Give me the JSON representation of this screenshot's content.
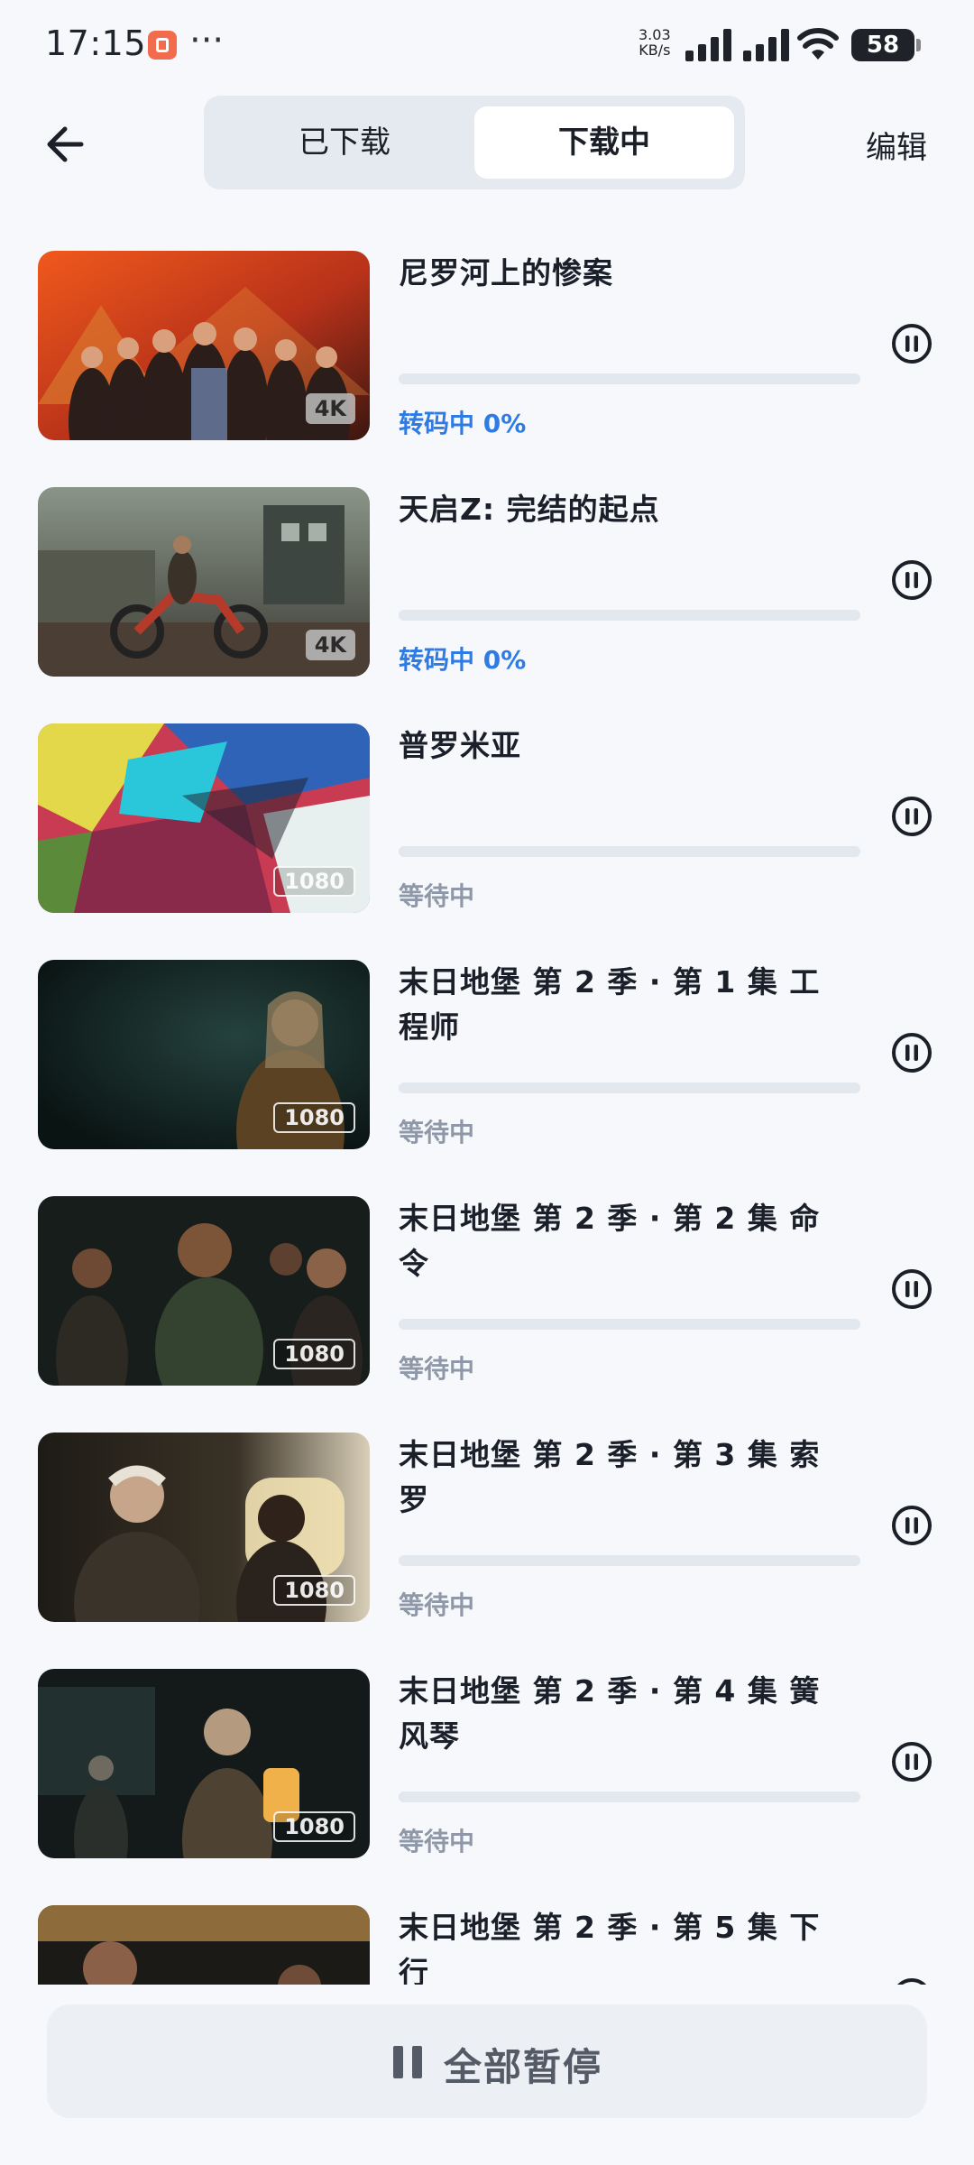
{
  "status_bar": {
    "time": "17:15",
    "speed_value": "3.03",
    "speed_unit": "KB/s",
    "battery": "58"
  },
  "header": {
    "tabs": [
      "已下载",
      "下载中"
    ],
    "active_tab": "下载中",
    "edit_label": "编辑"
  },
  "items": [
    {
      "title": "尼罗河上的惨案",
      "badge": "4K",
      "status": "转码中 0%",
      "status_type": "transcoding",
      "progress": 0
    },
    {
      "title": "天启Z: 完结的起点",
      "badge": "4K",
      "status": "转码中 0%",
      "status_type": "transcoding",
      "progress": 0
    },
    {
      "title": "普罗米亚",
      "badge": "1080",
      "status": "等待中",
      "status_type": "waiting",
      "progress": 0
    },
    {
      "title": "末日地堡 第 2 季 · 第 1 集 工程师",
      "badge": "1080",
      "status": "等待中",
      "status_type": "waiting",
      "progress": 0
    },
    {
      "title": "末日地堡 第 2 季 · 第 2 集 命令",
      "badge": "1080",
      "status": "等待中",
      "status_type": "waiting",
      "progress": 0
    },
    {
      "title": "末日地堡 第 2 季 · 第 3 集 索罗",
      "badge": "1080",
      "status": "等待中",
      "status_type": "waiting",
      "progress": 0
    },
    {
      "title": "末日地堡 第 2 季 · 第 4 集 簧风琴",
      "badge": "1080",
      "status": "等待中",
      "status_type": "waiting",
      "progress": 0
    },
    {
      "title": "末日地堡 第 2 季 · 第 5 集 下行",
      "badge": "",
      "status": "",
      "status_type": "waiting",
      "progress": 0
    }
  ],
  "pause_all_label": "全部暂停",
  "icons": {
    "back": "arrow-left-icon",
    "pause": "pause-circle-icon",
    "pause_all": "pause-icon"
  },
  "colors": {
    "accent": "#2e7be6",
    "waiting": "#8f98a8",
    "background": "#f6f8fb"
  }
}
